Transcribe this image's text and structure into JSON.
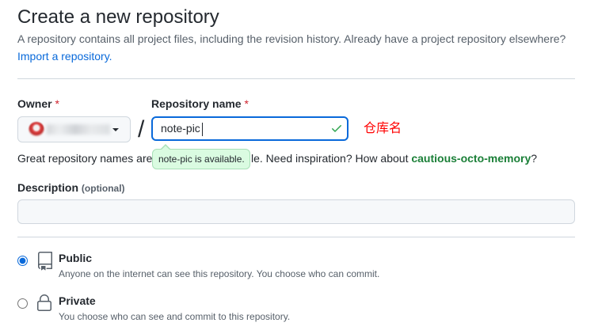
{
  "page": {
    "title": "Create a new repository",
    "subtitle": "A repository contains all project files, including the revision history. Already have a project repository elsewhere?",
    "import_link": "Import a repository."
  },
  "owner": {
    "label": "Owner",
    "required_mark": "*",
    "caret_icon": "triangle-down-icon"
  },
  "repository_name": {
    "label": "Repository name",
    "required_mark": "*",
    "separator": "/",
    "value": "note-pic",
    "status_icon": "check-icon",
    "availability_message": "note-pic is available.",
    "annotation": "仓库名"
  },
  "name_hint": {
    "before_tooltip": "Great repository names are",
    "after_tooltip": "le. Need inspiration? How about ",
    "suggestion": "cautious-octo-memory",
    "end": "?"
  },
  "description": {
    "label": "Description",
    "note": "(optional)",
    "value": ""
  },
  "visibility": {
    "options": [
      {
        "label": "Public",
        "description": "Anyone on the internet can see this repository. You choose who can commit.",
        "icon": "repo-icon",
        "checked": true
      },
      {
        "label": "Private",
        "description": "You choose who can see and commit to this repository.",
        "icon": "lock-icon",
        "checked": false
      }
    ]
  },
  "colors": {
    "accent": "#0969da",
    "success_text": "#1a7f37",
    "success_icon": "#2da44e",
    "danger": "#cf222e",
    "annotation": "#ff0000",
    "muted": "#57606a",
    "text": "#24292f",
    "border": "#d0d7de",
    "field_bg": "#f6f8fa",
    "tooltip_bg": "#dafbe1",
    "tooltip_border": "#a8e0b7"
  }
}
